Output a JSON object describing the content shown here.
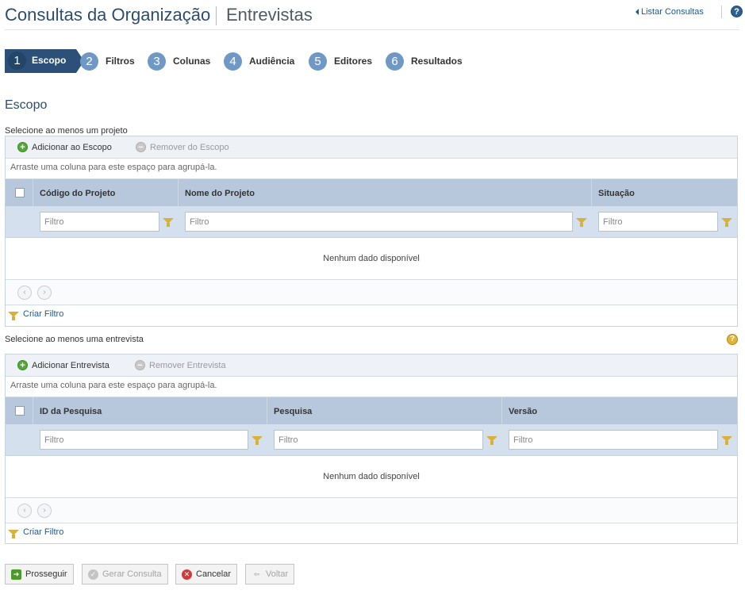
{
  "header": {
    "title": "Consultas da Organização",
    "subtitle": "Entrevistas",
    "list_link": "Listar Consultas",
    "help": "?"
  },
  "steps": [
    {
      "num": "1",
      "label": "Escopo"
    },
    {
      "num": "2",
      "label": "Filtros"
    },
    {
      "num": "3",
      "label": "Colunas"
    },
    {
      "num": "4",
      "label": "Audiência"
    },
    {
      "num": "5",
      "label": "Editores"
    },
    {
      "num": "6",
      "label": "Resultados"
    }
  ],
  "section_title": "Escopo",
  "projects": {
    "caption": "Selecione ao menos um projeto",
    "add_label": "Adicionar ao Escopo",
    "remove_label": "Remover do Escopo",
    "group_hint": "Arraste uma coluna para este espaço para agrupá-la.",
    "columns": [
      "Código do Projeto",
      "Nome do Projeto",
      "Situação"
    ],
    "filter_placeholder": "Filtro",
    "empty": "Nenhum dado disponível",
    "create_filter": "Criar Filtro"
  },
  "interviews": {
    "caption": "Selecione ao menos uma entrevista",
    "add_label": "Adicionar Entrevista",
    "remove_label": "Remover Entrevista",
    "group_hint": "Arraste uma coluna para este espaço para agrupá-la.",
    "columns": [
      "ID da Pesquisa",
      "Pesquisa",
      "Versão"
    ],
    "filter_placeholder": "Filtro",
    "empty": "Nenhum dado disponível",
    "create_filter": "Criar Filtro"
  },
  "buttons": {
    "proceed": "Prosseguir",
    "generate": "Gerar Consulta",
    "cancel": "Cancelar",
    "back": "Voltar"
  },
  "pager": {
    "prev": "‹",
    "next": "›"
  },
  "icons": {
    "add": "+",
    "remove": "−",
    "help_section": "?"
  }
}
